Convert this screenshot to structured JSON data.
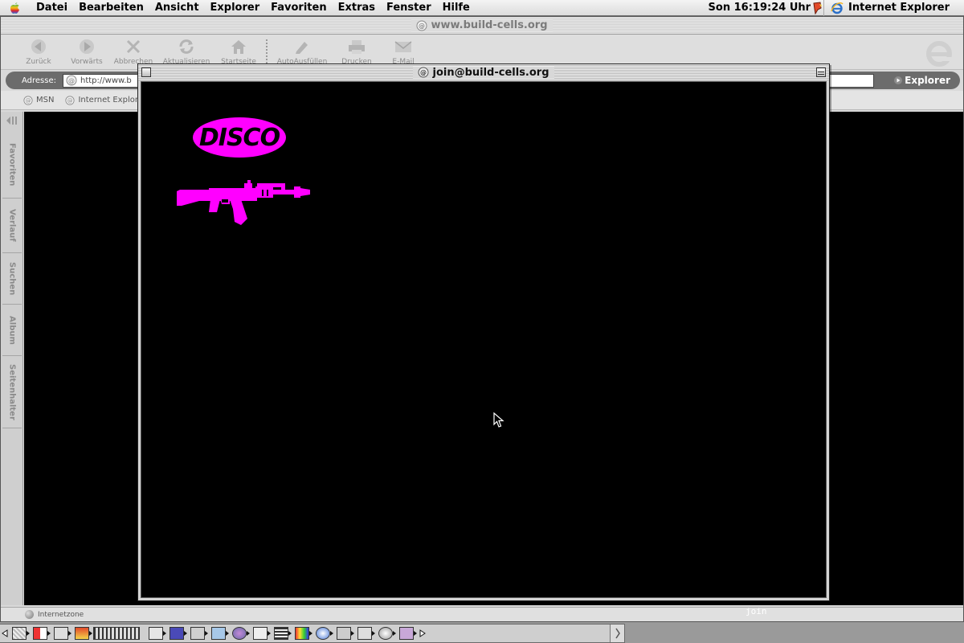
{
  "menubar": {
    "items": [
      "Datei",
      "Bearbeiten",
      "Ansicht",
      "Explorer",
      "Favoriten",
      "Extras",
      "Fenster",
      "Hilfe"
    ],
    "clock": "Son 16:19:24 Uhr",
    "active_app": "Internet Explorer"
  },
  "browser": {
    "title": "www.build-cells.org",
    "toolbar": {
      "buttons": [
        "Zurück",
        "Vorwärts",
        "Abbrechen",
        "Aktualisieren",
        "Startseite",
        "AutoAusfüllen",
        "Drucken",
        "E-Mail"
      ]
    },
    "address": {
      "label": "Adresse:",
      "value": "http://www.b",
      "go_label": "Explorer"
    },
    "favorites": [
      "MSN",
      "Internet Explor"
    ],
    "side_tabs": [
      "Favoriten",
      "Verlauf",
      "Suchen",
      "Album",
      "Seitenhalter"
    ],
    "status": "Internetzone"
  },
  "popup": {
    "title": "join@build-cells.org",
    "logo_text": "DISCO",
    "join_label": "join",
    "accent_color": "#ff00ff",
    "background_color": "#000000"
  },
  "icons": {
    "rifle": "assault-rifle-icon",
    "cursor": "arrow-cursor-icon"
  }
}
